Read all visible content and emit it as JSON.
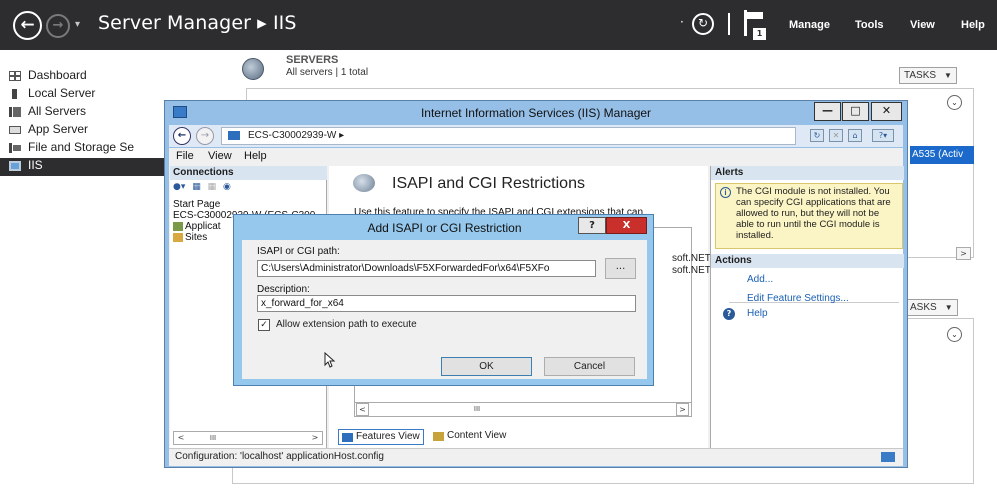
{
  "header": {
    "breadcrumb": "Server Manager ▸ IIS",
    "hist_glyph": "▾",
    "dot": "·",
    "refresh_glyph": "↻",
    "flag_count": "1",
    "menus": [
      "Manage",
      "Tools",
      "View",
      "Help"
    ]
  },
  "nav": {
    "items": [
      {
        "label": "Dashboard",
        "icon": "dashboard-icon"
      },
      {
        "label": "Local Server",
        "icon": "local-server-icon"
      },
      {
        "label": "All Servers",
        "icon": "all-servers-icon"
      },
      {
        "label": "App Server",
        "icon": "app-server-icon"
      },
      {
        "label": "File and Storage Se",
        "icon": "file-storage-icon"
      },
      {
        "label": "IIS",
        "icon": "iis-icon",
        "active": true
      }
    ]
  },
  "servers": {
    "title": "SERVERS",
    "subtitle": "All servers | 1 total",
    "tasks_label": "TASKS",
    "selected_row_text": "A535 (Activ",
    "tasks_label_2": "ASKS"
  },
  "iis": {
    "title": "Internet Information Services (IIS) Manager",
    "address": "ECS-C30002939-W  ▸",
    "menu": [
      "File",
      "View",
      "Help"
    ],
    "status": "Configuration: 'localhost' applicationHost.config",
    "connections": {
      "header": "Connections",
      "tree": [
        "Start Page",
        "ECS-C30002939-W (ECS-C300",
        "Applicat",
        "Sites"
      ]
    },
    "feature": {
      "title": "ISAPI and CGI Restrictions",
      "description": "Use this feature to specify the ISAPI and CGI extensions that can",
      "rows": [
        "soft.NET",
        "soft.NET"
      ],
      "views": [
        "Features View",
        "Content View"
      ]
    },
    "alerts": {
      "header": "Alerts",
      "message": "The CGI module is not installed. You can specify CGI applications that are allowed to run, but they will not be able to run until the CGI module is installed."
    },
    "actions": {
      "header": "Actions",
      "items": [
        "Add...",
        "Edit Feature Settings...",
        "Help"
      ]
    }
  },
  "dialog": {
    "title": "Add ISAPI or CGI Restriction",
    "help_btn": "?",
    "close_btn": "X",
    "path_label": "ISAPI or CGI path:",
    "path_value": "C:\\Users\\Administrator\\Downloads\\F5XForwardedFor\\x64\\F5XFo",
    "browse": "...",
    "desc_label": "Description:",
    "desc_value": "x_forward_for_x64",
    "allow_label": "Allow extension path to execute",
    "allow_checked": true,
    "ok": "OK",
    "cancel": "Cancel"
  }
}
